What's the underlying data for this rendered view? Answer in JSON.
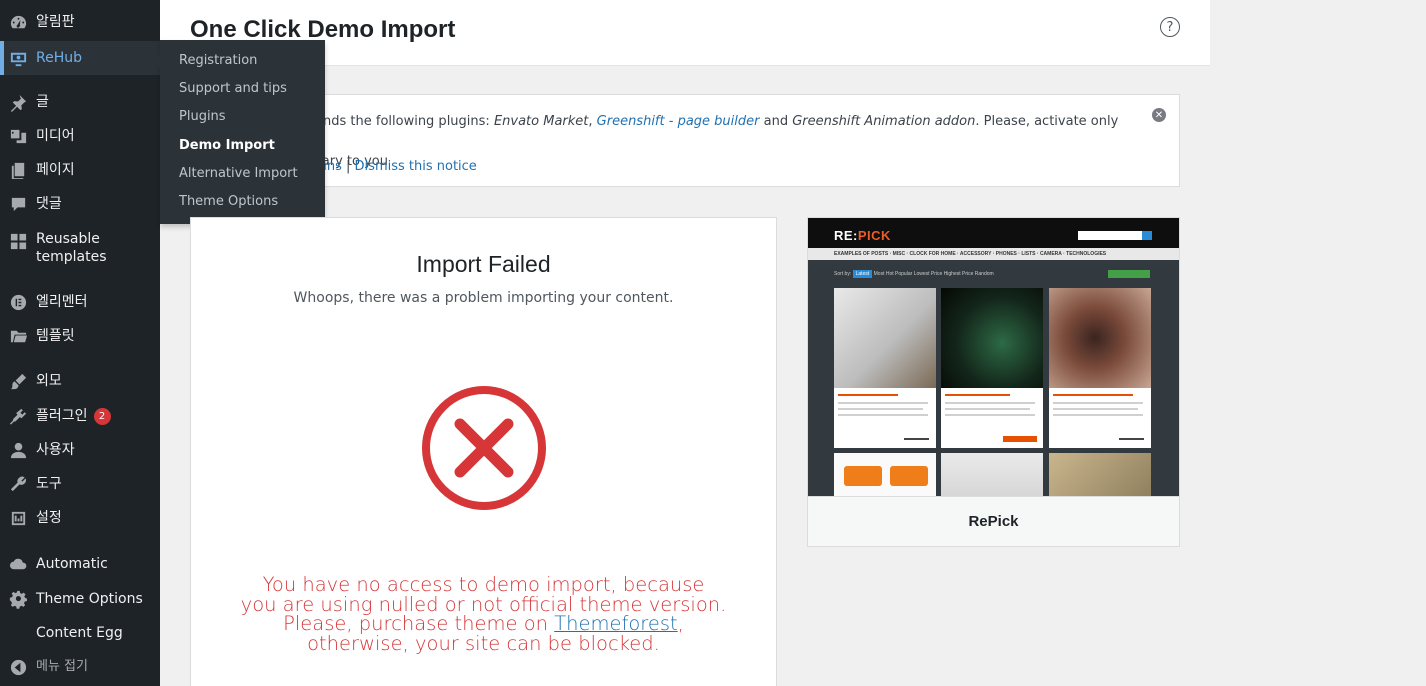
{
  "sidebar": {
    "items": [
      {
        "label": "알림판",
        "icon": "dashboard-icon"
      },
      {
        "label": "ReHub",
        "icon": "rehub-icon"
      },
      {
        "label": "글",
        "icon": "pin-icon"
      },
      {
        "label": "미디어",
        "icon": "media-icon"
      },
      {
        "label": "페이지",
        "icon": "page-icon"
      },
      {
        "label": "댓글",
        "icon": "comment-icon"
      },
      {
        "label": "Reusable templates",
        "icon": "grid-icon"
      },
      {
        "label": "엘리멘터",
        "icon": "elementor-icon"
      },
      {
        "label": "템플릿",
        "icon": "folder-icon"
      },
      {
        "label": "외모",
        "icon": "brush-icon"
      },
      {
        "label": "플러그인",
        "icon": "plugin-icon",
        "badge": "2"
      },
      {
        "label": "사용자",
        "icon": "user-icon"
      },
      {
        "label": "도구",
        "icon": "wrench-icon"
      },
      {
        "label": "설정",
        "icon": "settings-icon"
      },
      {
        "label": "Automatic",
        "icon": "cloud-icon"
      },
      {
        "label": "Theme Options",
        "icon": "gear-icon"
      },
      {
        "label": "Content Egg",
        "icon": ""
      }
    ],
    "collapse_label": "메뉴 접기"
  },
  "submenu": {
    "items": [
      "Registration",
      "Support and tips",
      "Plugins",
      "Demo Import",
      "Alternative Import",
      "Theme Options"
    ],
    "active": "Demo Import"
  },
  "header": {
    "title": "One Click Demo Import",
    "help_symbol": "?"
  },
  "notice": {
    "text_prefix": "ends the following plugins: ",
    "plugin_1": "Envato Market",
    "sep_1": ", ",
    "plugin_2": "Greenshift - page builder",
    "sep_2": " and ",
    "plugin_3": "Greenshift Animation addon",
    "text_suffix": ". Please, activate only those plug-",
    "text_line2": "sary to you",
    "link_1": "gins",
    "link_sep": " | ",
    "link_2": "Dismiss this notice"
  },
  "import": {
    "title": "Import Failed",
    "subtitle": "Whoops, there was a problem importing your content.",
    "error_line1": "You have no access to demo import, because",
    "error_line2": "you are using nulled or not official theme version.",
    "error_line3_prefix": "Please, purchase theme on ",
    "error_link": "Themeforest",
    "error_line3_suffix": ",",
    "error_line4": "otherwise, your site can be blocked."
  },
  "demo": {
    "name": "RePick",
    "preview": {
      "logo_main": "RE:",
      "logo_accent": "PICK",
      "nav": "EXAMPLES OF POSTS · MISC · CLOCK FOR HOME · ACCESSORY · PHONES · LISTS · CAMERA · TECHNOLOGIES",
      "tab_active": "Latest",
      "tabs": "Most Hot   Popular   Lowest Price   Highest Price   Random"
    }
  },
  "colors": {
    "sidebar_bg": "#1d2327",
    "accent": "#72aee6",
    "error": "#d63638",
    "link": "#2271b1"
  }
}
